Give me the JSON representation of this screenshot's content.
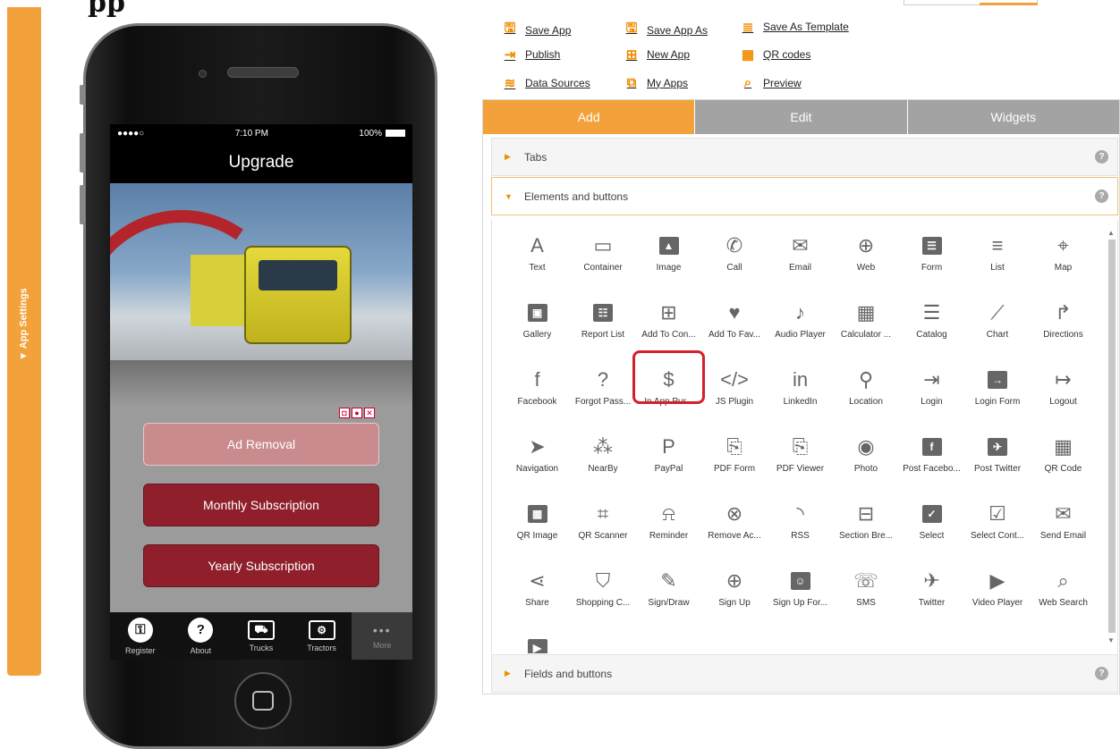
{
  "heading_fragment": "pp",
  "sidebar": {
    "label": "▼ App Settings"
  },
  "phone": {
    "status": {
      "signal": "●●●●○",
      "time": "7:10 PM",
      "battery": "100%"
    },
    "title": "Upgrade",
    "ad_controls": [
      "◘",
      "●",
      "✕"
    ],
    "buttons": {
      "ad_removal": "Ad Removal",
      "monthly": "Monthly Subscription",
      "yearly": "Yearly Subscription"
    },
    "tabs": [
      {
        "label": "Register",
        "icon": "key-icon",
        "glyph": "⚿"
      },
      {
        "label": "About",
        "icon": "question-icon",
        "glyph": "?"
      },
      {
        "label": "Trucks",
        "icon": "truck-icon",
        "glyph": "⛟"
      },
      {
        "label": "Tractors",
        "icon": "tractor-icon",
        "glyph": "⚙"
      },
      {
        "label": "More",
        "icon": "more-icon",
        "glyph": "•••"
      }
    ]
  },
  "toolbar": {
    "save_app": "Save App",
    "save_app_as": "Save App As",
    "save_as_template": "Save As Template",
    "publish": "Publish",
    "new_app": "New App",
    "qr_codes": "QR codes",
    "data_sources": "Data Sources",
    "my_apps": "My Apps",
    "preview": "Preview"
  },
  "panel": {
    "tabs": [
      "Add",
      "Edit",
      "Widgets"
    ],
    "sections": {
      "tabs": "Tabs",
      "elements": "Elements and buttons",
      "fields": "Fields and buttons"
    },
    "elements": [
      {
        "label": "Text",
        "glyph": "A",
        "icon": "text-icon"
      },
      {
        "label": "Container",
        "glyph": "▭",
        "icon": "folder-icon"
      },
      {
        "label": "Image",
        "glyph": "▲",
        "icon": "image-icon",
        "box": true
      },
      {
        "label": "Call",
        "glyph": "✆",
        "icon": "phone-icon"
      },
      {
        "label": "Email",
        "glyph": "✉",
        "icon": "email-icon"
      },
      {
        "label": "Web",
        "glyph": "⊕",
        "icon": "globe-icon"
      },
      {
        "label": "Form",
        "glyph": "☰",
        "icon": "form-icon",
        "box": true
      },
      {
        "label": "List",
        "glyph": "≡",
        "icon": "list-icon"
      },
      {
        "label": "Map",
        "glyph": "⌖",
        "icon": "map-icon"
      },
      {
        "label": "Gallery",
        "glyph": "▣",
        "icon": "gallery-icon",
        "box": true
      },
      {
        "label": "Report List",
        "glyph": "☷",
        "icon": "report-list-icon",
        "box": true
      },
      {
        "label": "Add To Con...",
        "glyph": "⊞",
        "icon": "add-contact-icon"
      },
      {
        "label": "Add To Fav...",
        "glyph": "♥",
        "icon": "add-favorite-icon"
      },
      {
        "label": "Audio Player",
        "glyph": "♪",
        "icon": "audio-icon"
      },
      {
        "label": "Calculator ...",
        "glyph": "▦",
        "icon": "calculator-icon"
      },
      {
        "label": "Catalog",
        "glyph": "☰",
        "icon": "catalog-icon"
      },
      {
        "label": "Chart",
        "glyph": "⟋",
        "icon": "chart-icon"
      },
      {
        "label": "Directions",
        "glyph": "↱",
        "icon": "directions-icon"
      },
      {
        "label": "Facebook",
        "glyph": "f",
        "icon": "facebook-icon"
      },
      {
        "label": "Forgot Pass...",
        "glyph": "?",
        "icon": "question-icon"
      },
      {
        "label": "In App Pur...",
        "glyph": "$",
        "icon": "dollar-icon"
      },
      {
        "label": "JS Plugin",
        "glyph": "</>",
        "icon": "code-icon"
      },
      {
        "label": "LinkedIn",
        "glyph": "in",
        "icon": "linkedin-icon"
      },
      {
        "label": "Location",
        "glyph": "⚲",
        "icon": "location-icon"
      },
      {
        "label": "Login",
        "glyph": "⇥",
        "icon": "login-icon"
      },
      {
        "label": "Login Form",
        "glyph": "→",
        "icon": "login-form-icon",
        "box": true
      },
      {
        "label": "Logout",
        "glyph": "↦",
        "icon": "logout-icon"
      },
      {
        "label": "Navigation",
        "glyph": "➤",
        "icon": "navigation-icon"
      },
      {
        "label": "NearBy",
        "glyph": "⁂",
        "icon": "nearby-icon"
      },
      {
        "label": "PayPal",
        "glyph": "P",
        "icon": "paypal-icon"
      },
      {
        "label": "PDF Form",
        "glyph": "⎘",
        "icon": "pdf-form-icon"
      },
      {
        "label": "PDF Viewer",
        "glyph": "⎘",
        "icon": "pdf-viewer-icon"
      },
      {
        "label": "Photo",
        "glyph": "◉",
        "icon": "camera-icon"
      },
      {
        "label": "Post Facebo...",
        "glyph": "f",
        "icon": "post-facebook-icon",
        "box": true
      },
      {
        "label": "Post Twitter",
        "glyph": "✈",
        "icon": "post-twitter-icon",
        "box": true
      },
      {
        "label": "QR Code",
        "glyph": "▦",
        "icon": "qr-code-icon"
      },
      {
        "label": "QR Image",
        "glyph": "▦",
        "icon": "qr-image-icon",
        "box": true
      },
      {
        "label": "QR Scanner",
        "glyph": "⌗",
        "icon": "qr-scanner-icon"
      },
      {
        "label": "Reminder",
        "glyph": "⍾",
        "icon": "bell-icon"
      },
      {
        "label": "Remove Ac...",
        "glyph": "⊗",
        "icon": "remove-account-icon"
      },
      {
        "label": "RSS",
        "glyph": "◝",
        "icon": "rss-icon"
      },
      {
        "label": "Section Bre...",
        "glyph": "⊟",
        "icon": "section-break-icon"
      },
      {
        "label": "Select",
        "glyph": "✓",
        "icon": "select-icon",
        "box": true
      },
      {
        "label": "Select Cont...",
        "glyph": "☑",
        "icon": "select-contact-icon"
      },
      {
        "label": "Send Email",
        "glyph": "✉",
        "icon": "send-email-icon"
      },
      {
        "label": "Share",
        "glyph": "⋖",
        "icon": "share-icon"
      },
      {
        "label": "Shopping C...",
        "glyph": "⛉",
        "icon": "cart-icon"
      },
      {
        "label": "Sign/Draw",
        "glyph": "✎",
        "icon": "pencil-icon"
      },
      {
        "label": "Sign Up",
        "glyph": "⊕",
        "icon": "sign-up-icon"
      },
      {
        "label": "Sign Up For...",
        "glyph": "☺",
        "icon": "sign-up-form-icon",
        "box": true
      },
      {
        "label": "SMS",
        "glyph": "☏",
        "icon": "sms-icon"
      },
      {
        "label": "Twitter",
        "glyph": "✈",
        "icon": "twitter-icon"
      },
      {
        "label": "Video Player",
        "glyph": "▶",
        "icon": "video-icon"
      },
      {
        "label": "Web Search",
        "glyph": "⌕",
        "icon": "search-icon"
      },
      {
        "label": "",
        "glyph": "▶",
        "icon": "youtube-icon",
        "box": true
      }
    ],
    "highlighted": "In App Pur..."
  },
  "colors": {
    "accent": "#f3a23b",
    "inactive_tab": "#a3a3a3",
    "button_dark": "#8e1f2b",
    "highlight": "#d4202a"
  }
}
